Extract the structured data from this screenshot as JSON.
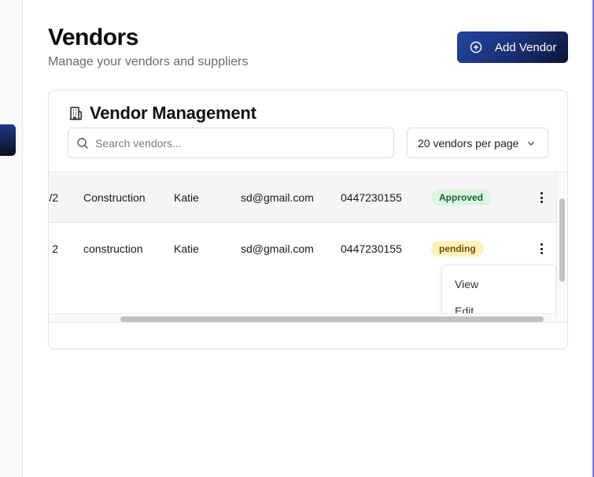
{
  "header": {
    "title": "Vendors",
    "subtitle": "Manage your vendors and suppliers",
    "add_button_label": "Add Vendor"
  },
  "card": {
    "title": "Vendor Management",
    "search_placeholder": "Search vendors...",
    "search_value": "",
    "per_page_selected": "20 vendors per page"
  },
  "table": {
    "rows": [
      {
        "id_fragment": "/2",
        "type": "Construction",
        "name": "Katie",
        "email": "sd@gmail.com",
        "phone": "0447230155",
        "status": "Approved"
      },
      {
        "id_fragment": "2",
        "type": "construction",
        "name": "Katie",
        "email": "sd@gmail.com",
        "phone": "0447230155",
        "status": "pending"
      }
    ]
  },
  "row_menu": {
    "items": [
      "View",
      "Edit"
    ]
  },
  "colors": {
    "accent": "#1e3a8a",
    "approved_bg": "#dcf5e3",
    "approved_text": "#166534",
    "pending_bg": "#fdf2b8",
    "pending_text": "#7a4a0b"
  },
  "icons": {
    "add": "plus-circle-icon",
    "building": "building-icon",
    "search": "search-icon",
    "chevron": "chevron-down-icon",
    "row_actions": "more-vertical-icon"
  }
}
